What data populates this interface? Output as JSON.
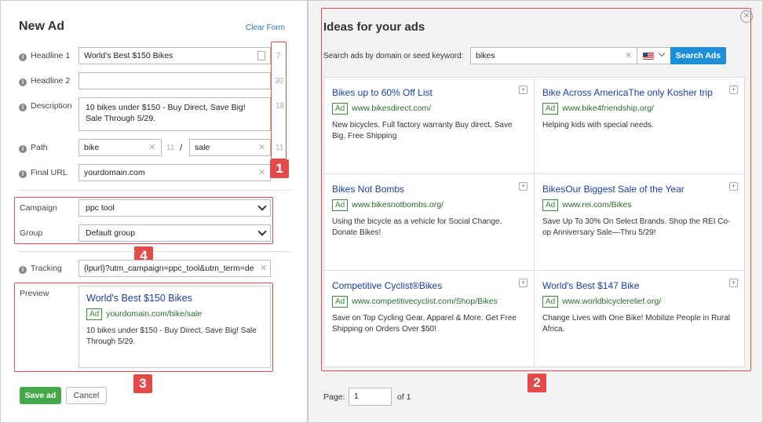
{
  "new_ad": {
    "title": "New Ad",
    "clear_form": "Clear Form",
    "fields": {
      "headline1": {
        "label": "Headline 1",
        "value": "World's Best $150 Bikes",
        "count": "7"
      },
      "headline2": {
        "label": "Headline 2",
        "value": "",
        "count": "30"
      },
      "description": {
        "label": "Description",
        "value": "10 bikes under $150 - Buy Direct, Save Big! Sale Through 5/29.",
        "count": "18"
      },
      "path": {
        "label": "Path",
        "value1": "bike",
        "count1": "11",
        "separator": "/",
        "value2": "sale",
        "count2": "11"
      },
      "final_url": {
        "label": "Final URL",
        "value": "yourdomain.com"
      }
    },
    "campaign": {
      "label": "Campaign",
      "value": "ppc tool"
    },
    "group": {
      "label": "Group",
      "value": "Default group"
    },
    "tracking": {
      "label": "Tracking",
      "value": "{lpurl}?utm_campaign=ppc_tool&utm_term=de"
    },
    "preview": {
      "label": "Preview",
      "title": "World's Best $150 Bikes",
      "ad_tag": "Ad",
      "url": "yourdomain.com/bike/sale",
      "desc": "10 bikes under $150 - Buy Direct, Save Big! Sale Through 5/29."
    },
    "save_label": "Save ad",
    "cancel_label": "Cancel"
  },
  "badges": [
    "1",
    "2",
    "3",
    "4"
  ],
  "ideas": {
    "title": "Ideas for your ads",
    "search_label": "Search ads by domain or seed keyword:",
    "search_value": "bikes",
    "search_button": "Search Ads",
    "country_icon": "us-flag-icon",
    "ad_tag": "Ad",
    "cards": [
      {
        "title": "Bikes up to 60% Off List",
        "url": "www.bikesdirect.com/",
        "desc": "New bicycles. Full factory warranty Buy direct. Save Big. Free Shipping"
      },
      {
        "title": "Bike Across AmericaThe only Kosher trip",
        "url": "www.bike4friendship.org/",
        "desc": "Helping kids with special needs."
      },
      {
        "title": "Bikes Not Bombs",
        "url": "www.bikesnotbombs.org/",
        "desc": "Using the bicycle as a vehicle for Social Change. Donate Bikes!"
      },
      {
        "title": "BikesOur Biggest Sale of the Year",
        "url": "www.rei.com/Bikes",
        "desc": "Save Up To 30% On Select Brands. Shop the REI Co-op Anniversary Sale—Thru 5/29!"
      },
      {
        "title": "Competitive Cyclist®Bikes",
        "url": "www.competitivecyclist.com/Shop/Bikes",
        "desc": "Save on Top Cycling Gear, Apparel & More. Get Free Shipping on Orders Over $50!"
      },
      {
        "title": "World's Best $147 Bike",
        "url": "www.worldbicyclerelief.org/",
        "desc": "Change Lives with One Bike! Mobilize People in Rural Africa."
      }
    ],
    "page_label": "Page:",
    "page_value": "1",
    "page_of": "of 1"
  },
  "colors": {
    "accent": "#2a7ab0",
    "search_button": "#1e8fd6",
    "save": "#44a848",
    "highlight": "#e34b4b",
    "ad_title": "#1a3fa0",
    "ad_url": "#2a6a2a"
  }
}
